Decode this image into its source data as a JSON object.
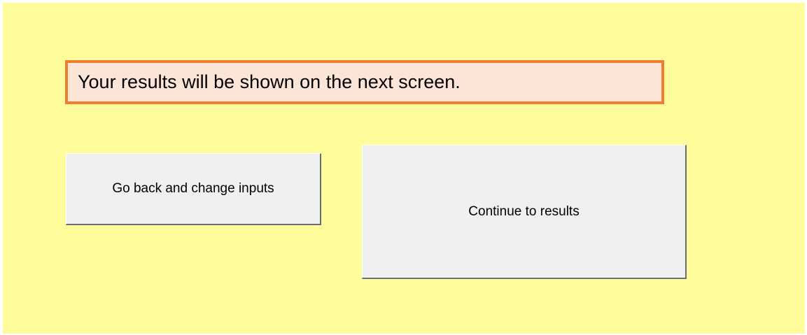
{
  "message": {
    "text": "Your results will be shown on the next screen."
  },
  "buttons": {
    "back_label": "Go back and change inputs",
    "continue_label": "Continue to results"
  },
  "colors": {
    "background": "#fffc9c",
    "message_fill": "#fbe5d6",
    "message_border": "#ed7d31",
    "button_face": "#f0f0f0"
  }
}
